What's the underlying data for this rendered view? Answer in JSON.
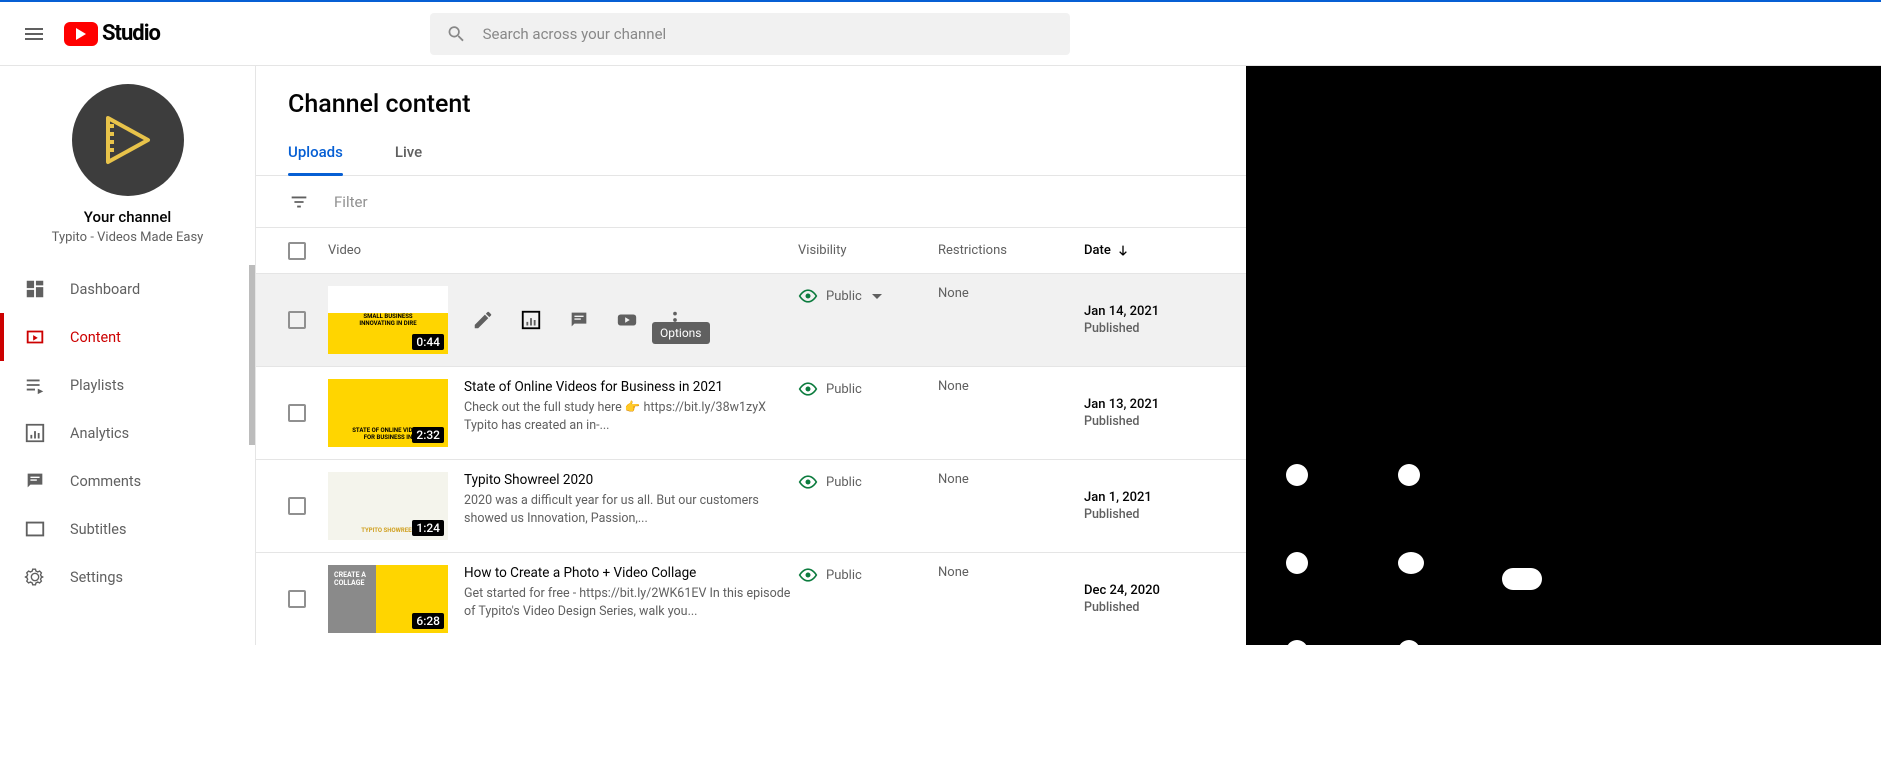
{
  "logo_text": "Studio",
  "search_placeholder": "Search across your channel",
  "channel": {
    "label": "Your channel",
    "name": "Typito - Videos Made Easy"
  },
  "nav": {
    "dashboard": "Dashboard",
    "content": "Content",
    "playlists": "Playlists",
    "analytics": "Analytics",
    "comments": "Comments",
    "subtitles": "Subtitles",
    "settings": "Settings"
  },
  "page_title": "Channel content",
  "tabs": {
    "uploads": "Uploads",
    "live": "Live"
  },
  "filter_placeholder": "Filter",
  "columns": {
    "video": "Video",
    "visibility": "Visibility",
    "restrictions": "Restrictions",
    "date": "Date"
  },
  "hover_tooltip": "Options",
  "rows": [
    {
      "duration": "0:44",
      "thumb_text1": "SMALL BUSINESS",
      "thumb_text2": "INNOVATING IN DIRE",
      "visibility": "Public",
      "restrictions": "None",
      "date": "Jan 14, 2021",
      "status": "Published",
      "has_caret": true
    },
    {
      "duration": "2:32",
      "thumb_text1": "STATE OF ONLINE VIDEOS",
      "thumb_text2": "FOR BUSINESS IN",
      "title": "State of Online Videos for Business in 2021",
      "desc": "Check out the full study here 👉 https://bit.ly/38w1zyX Typito has created an in-...",
      "visibility": "Public",
      "restrictions": "None",
      "date": "Jan 13, 2021",
      "status": "Published"
    },
    {
      "duration": "1:24",
      "thumb_text1": "",
      "thumb_text2": "TYPITO SHOWREEL",
      "title": "Typito Showreel 2020",
      "desc": "2020 was a difficult year for us all. But our customers showed us Innovation, Passion,...",
      "visibility": "Public",
      "restrictions": "None",
      "date": "Jan 1, 2021",
      "status": "Published"
    },
    {
      "duration": "6:28",
      "thumb_text1": "CREATE A",
      "thumb_text2": "COLLAGE",
      "title": "How to Create a Photo + Video Collage",
      "desc": "Get started for free - https://bit.ly/2WK61EV In this episode of Typito's Video Design Series, walk you...",
      "visibility": "Public",
      "restrictions": "None",
      "date": "Dec 24, 2020",
      "status": "Published"
    }
  ]
}
